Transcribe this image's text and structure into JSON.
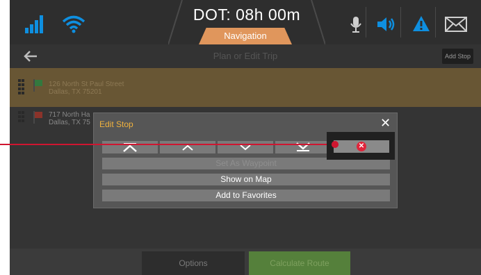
{
  "header": {
    "dot_label": "DOT: 08h 00m",
    "mode_tab": "Navigation",
    "icons": [
      "signal-icon",
      "wifi-icon",
      "microphone-icon",
      "speaker-icon",
      "warning-icon",
      "mail-icon"
    ],
    "accent_color": "#0e8fe0"
  },
  "titlebar": {
    "title": "Plan or Edit Trip",
    "add_stop": "Add Stop"
  },
  "stops": [
    {
      "line1": "126 North St Paul Street",
      "line2": "Dallas, TX 75201",
      "flag_color": "#3aa34a"
    },
    {
      "line1": "717 North Ha",
      "line2": "Dallas, TX 75",
      "flag_color": "#c0392b"
    }
  ],
  "modal": {
    "title": "Edit Stop",
    "close": "✕",
    "remove_icon": "✕",
    "set_waypoint": "Set As Waypoint",
    "show_on_map": "Show on Map",
    "add_favorites": "Add to Favorites"
  },
  "bottom": {
    "options": "Options",
    "calculate": "Calculate Route"
  }
}
